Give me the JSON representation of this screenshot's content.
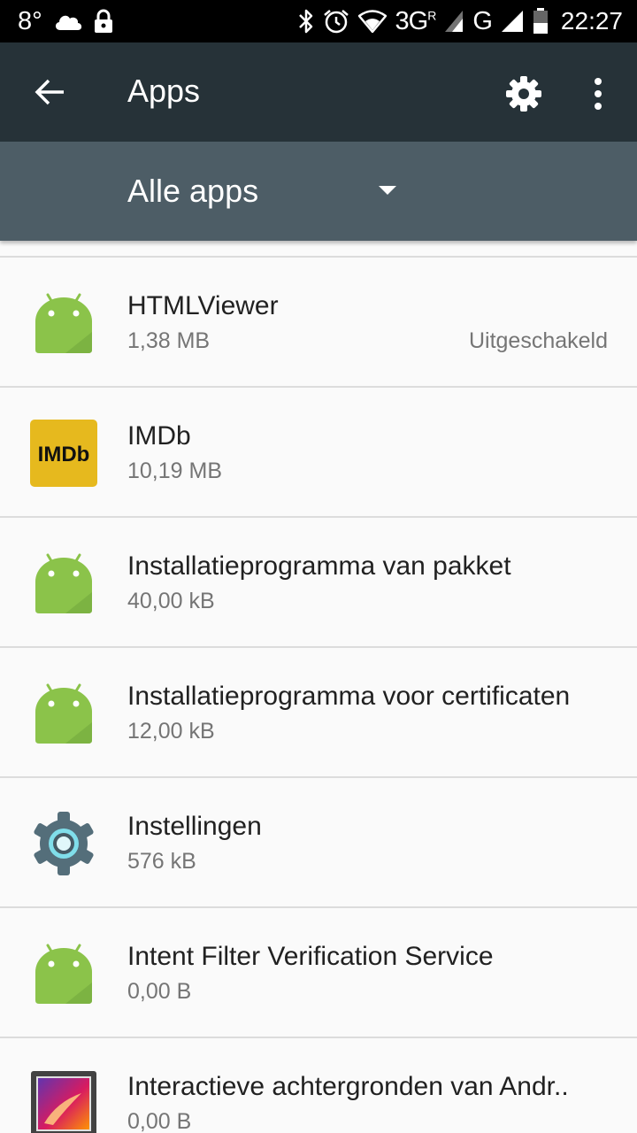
{
  "status_bar": {
    "temperature": "8°",
    "network_3g": "3G",
    "network_roaming": "R",
    "network_g": "G",
    "time": "22:27",
    "icons": [
      "cloud-icon",
      "lock-icon",
      "bluetooth-icon",
      "alarm-icon",
      "wifi-icon",
      "signal-icon",
      "battery-icon"
    ]
  },
  "toolbar": {
    "title": "Apps",
    "back_icon": "arrow-back-icon",
    "settings_icon": "gear-icon",
    "overflow_icon": "more-vert-icon"
  },
  "filter": {
    "selected": "Alle apps"
  },
  "apps": [
    {
      "name": "HTMLViewer",
      "size": "1,38 MB",
      "status": "Uitgeschakeld",
      "icon": "android-icon"
    },
    {
      "name": "IMDb",
      "size": "10,19 MB",
      "status": "",
      "icon": "imdb-icon",
      "icon_text": "IMDb"
    },
    {
      "name": "Installatieprogramma van pakket",
      "size": "40,00 kB",
      "status": "",
      "icon": "android-icon"
    },
    {
      "name": "Installatieprogramma voor certificaten",
      "size": "12,00 kB",
      "status": "",
      "icon": "android-icon"
    },
    {
      "name": "Instellingen",
      "size": "576 kB",
      "status": "",
      "icon": "settings-app-icon"
    },
    {
      "name": "Intent Filter Verification Service",
      "size": "0,00 B",
      "status": "",
      "icon": "android-icon"
    },
    {
      "name": "Interactieve achtergronden van Andr..",
      "size": "0,00 B",
      "status": "",
      "icon": "live-wallpaper-icon"
    }
  ],
  "colors": {
    "status_bar": "#000000",
    "toolbar": "#263238",
    "filter_bar": "#4d5d66",
    "background": "#fafafa",
    "android_green": "#8bc34a",
    "imdb_yellow": "#e6b91e"
  }
}
